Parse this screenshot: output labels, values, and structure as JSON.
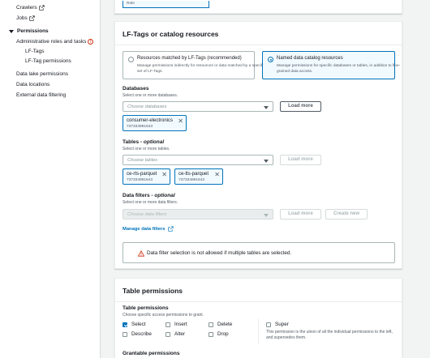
{
  "sidebar": {
    "crawlers": "Crawlers",
    "jobs": "Jobs",
    "permissions": "Permissions",
    "admin_roles": "Administrative roles and tasks",
    "lf_tags": "LF-Tags",
    "lf_tag_permissions": "LF-Tag permissions",
    "data_lake_permissions": "Data lake permissions",
    "data_locations": "Data locations",
    "external_filtering": "External data filtering"
  },
  "top_panel": {
    "role_label": "Role"
  },
  "lf_panel": {
    "title": "LF-Tags or catalog resources",
    "option1_title": "Resources matched by LF-Tags (recommended)",
    "option1_desc": "Manage permissions indirectly for resources or data matched by a specific set of LF-Tags.",
    "option2_title": "Named data catalog resources",
    "option2_desc": "Manage permissions for specific databases or tables, in addition to fine-grained data access.",
    "databases_label": "Databases",
    "databases_desc": "Select one or more databases.",
    "databases_placeholder": "Choose databases",
    "load_more": "Load more",
    "db_token_name": "consumer-electronics",
    "db_token_account": "737334991643",
    "tables_label": "Tables",
    "tables_optional": "optional",
    "tables_desc": "Select one or more tables.",
    "tables_placeholder": "Choose tables",
    "table_tokens": [
      {
        "name": "ce-rts-parquet",
        "account": "737334991643"
      },
      {
        "name": "ce-tts-parquet",
        "account": "737334991643"
      }
    ],
    "filters_label": "Data filters",
    "filters_optional": "optional",
    "filters_desc": "Select one or more data filters.",
    "filters_placeholder": "Choose data filters",
    "create_new": "Create new",
    "manage_filters": "Manage data filters",
    "alert_text": "Data filter selection is not allowed if multiple tables are selected."
  },
  "table_perm_panel": {
    "title": "Table permissions",
    "perm_label": "Table permissions",
    "perm_desc": "Choose specific access permissions to grant.",
    "checkboxes": {
      "select": {
        "label": "Select",
        "checked": true
      },
      "insert": {
        "label": "Insert",
        "checked": false
      },
      "delete": {
        "label": "Delete",
        "checked": false
      },
      "describe": {
        "label": "Describe",
        "checked": false
      },
      "alter": {
        "label": "Alter",
        "checked": false
      },
      "drop": {
        "label": "Drop",
        "checked": false
      },
      "super": {
        "label": "Super",
        "checked": false
      }
    },
    "super_desc": "This permission is the union of all the individual permissions to the left, and supersedes them.",
    "grantable_label": "Grantable permissions"
  },
  "colors": {
    "accent": "#0073bb",
    "warning": "#d13212"
  }
}
